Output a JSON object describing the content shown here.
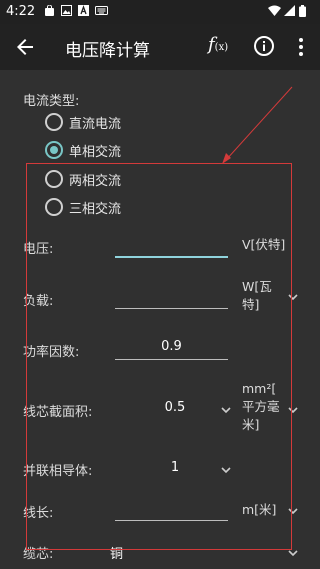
{
  "status_bar": {
    "time": "4:22",
    "icons": [
      "bag-icon",
      "image-icon",
      "a-icon",
      "keyboard-icon",
      "wifi-icon",
      "signal-icon",
      "battery-icon"
    ]
  },
  "app_bar": {
    "title": "电压降计算",
    "formula_label": "f",
    "formula_sub": "(x)",
    "icons": [
      "back-arrow-icon",
      "info-icon",
      "more-vert-icon"
    ]
  },
  "current_type": {
    "label": "电流类型:",
    "options": [
      {
        "label": "直流电流",
        "checked": false
      },
      {
        "label": "单相交流",
        "checked": true
      },
      {
        "label": "两相交流",
        "checked": false
      },
      {
        "label": "三相交流",
        "checked": false
      }
    ]
  },
  "fields": {
    "voltage": {
      "label": "电压:",
      "value": "",
      "unit": "V[伏特]"
    },
    "load": {
      "label": "负载:",
      "value": "",
      "unit_line1": "W[瓦",
      "unit_line2": "特]"
    },
    "power_factor": {
      "label": "功率因数:",
      "value": "0.9"
    },
    "cross_section": {
      "label": "线芯截面积:",
      "value": "0.5",
      "unit_line1": "mm²[",
      "unit_line2": "平方毫",
      "unit_line3": "米]"
    },
    "parallel_conductors": {
      "label": "并联相导体:",
      "value": "1"
    },
    "length": {
      "label": "线长:",
      "value": "",
      "unit": "m[米]"
    },
    "core": {
      "label": "缆芯:",
      "value": "铜"
    }
  },
  "colors": {
    "background": "#303030",
    "app_bar": "#222222",
    "accent": "#79c6c6",
    "annotation_red": "#d33a3a"
  }
}
